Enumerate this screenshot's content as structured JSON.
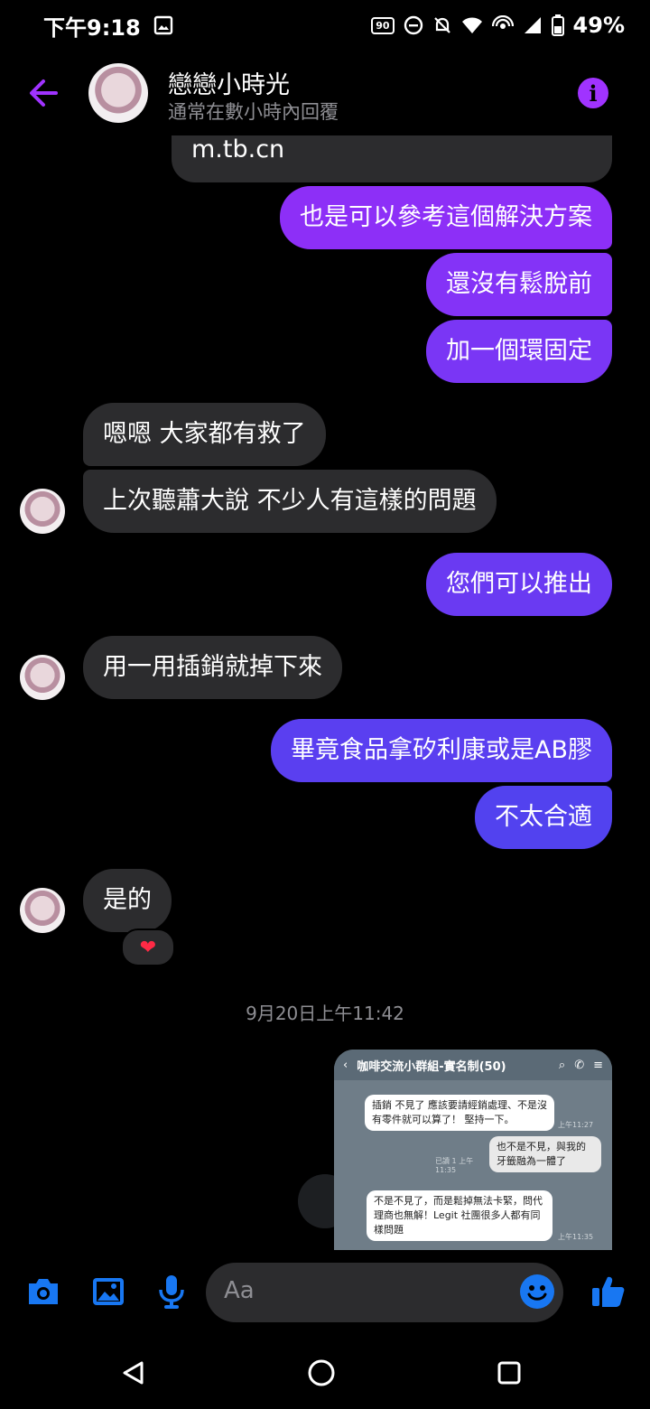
{
  "status_bar": {
    "time": "下午9:18",
    "refresh_rate": "90",
    "battery": "49%"
  },
  "header": {
    "name": "戀戀小時光",
    "subtitle": "通常在數小時內回覆"
  },
  "messages": [
    {
      "text": "m.tb.cn"
    },
    {
      "text": "也是可以參考這個解決方案"
    },
    {
      "text": "還沒有鬆脫前"
    },
    {
      "text": "加一個環固定"
    },
    {
      "text": "嗯嗯  大家都有救了"
    },
    {
      "text": "上次聽蕭大說 不少人有這樣的問題"
    },
    {
      "text": "您們可以推出"
    },
    {
      "text": "用一用插銷就掉下來"
    },
    {
      "text": "畢竟食品拿矽利康或是AB膠"
    },
    {
      "text": "不太合適"
    },
    {
      "text": "是的"
    }
  ],
  "reaction": "❤",
  "timestamp": "9月20日上午11:42",
  "shared_screenshot": {
    "title": "咖啡交流小群組-實名制(50)",
    "msg1": "插銷 不見了 應該要請經銷處理、不是沒有零件就可以算了！ 堅持一下。",
    "time1": "上午11:27",
    "msg2": "也不是不見，與我的牙籤融為一體了",
    "read2": "已讀 1 上午11:35",
    "msg3": "不是不見了，而是鬆掉無法卡緊，問代理商也無解！Legit 社團很多人都有同樣問題",
    "time3": "上午11:35"
  },
  "composer": {
    "placeholder": "Aa"
  },
  "colors": {
    "accent": "#a033ff",
    "in_bubble": "#2c2c2e",
    "messenger_blue": "#1877f2"
  }
}
